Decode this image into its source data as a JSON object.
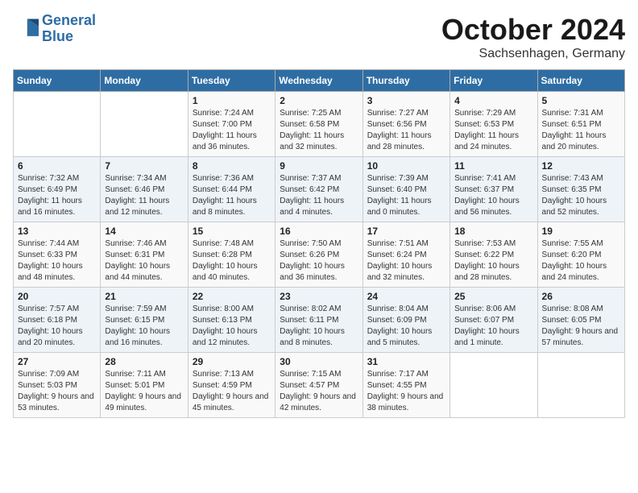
{
  "logo": {
    "line1": "General",
    "line2": "Blue"
  },
  "title": "October 2024",
  "location": "Sachsenhagen, Germany",
  "days_of_week": [
    "Sunday",
    "Monday",
    "Tuesday",
    "Wednesday",
    "Thursday",
    "Friday",
    "Saturday"
  ],
  "weeks": [
    [
      {
        "day": "",
        "sunrise": "",
        "sunset": "",
        "daylight": ""
      },
      {
        "day": "",
        "sunrise": "",
        "sunset": "",
        "daylight": ""
      },
      {
        "day": "1",
        "sunrise": "Sunrise: 7:24 AM",
        "sunset": "Sunset: 7:00 PM",
        "daylight": "Daylight: 11 hours and 36 minutes."
      },
      {
        "day": "2",
        "sunrise": "Sunrise: 7:25 AM",
        "sunset": "Sunset: 6:58 PM",
        "daylight": "Daylight: 11 hours and 32 minutes."
      },
      {
        "day": "3",
        "sunrise": "Sunrise: 7:27 AM",
        "sunset": "Sunset: 6:56 PM",
        "daylight": "Daylight: 11 hours and 28 minutes."
      },
      {
        "day": "4",
        "sunrise": "Sunrise: 7:29 AM",
        "sunset": "Sunset: 6:53 PM",
        "daylight": "Daylight: 11 hours and 24 minutes."
      },
      {
        "day": "5",
        "sunrise": "Sunrise: 7:31 AM",
        "sunset": "Sunset: 6:51 PM",
        "daylight": "Daylight: 11 hours and 20 minutes."
      }
    ],
    [
      {
        "day": "6",
        "sunrise": "Sunrise: 7:32 AM",
        "sunset": "Sunset: 6:49 PM",
        "daylight": "Daylight: 11 hours and 16 minutes."
      },
      {
        "day": "7",
        "sunrise": "Sunrise: 7:34 AM",
        "sunset": "Sunset: 6:46 PM",
        "daylight": "Daylight: 11 hours and 12 minutes."
      },
      {
        "day": "8",
        "sunrise": "Sunrise: 7:36 AM",
        "sunset": "Sunset: 6:44 PM",
        "daylight": "Daylight: 11 hours and 8 minutes."
      },
      {
        "day": "9",
        "sunrise": "Sunrise: 7:37 AM",
        "sunset": "Sunset: 6:42 PM",
        "daylight": "Daylight: 11 hours and 4 minutes."
      },
      {
        "day": "10",
        "sunrise": "Sunrise: 7:39 AM",
        "sunset": "Sunset: 6:40 PM",
        "daylight": "Daylight: 11 hours and 0 minutes."
      },
      {
        "day": "11",
        "sunrise": "Sunrise: 7:41 AM",
        "sunset": "Sunset: 6:37 PM",
        "daylight": "Daylight: 10 hours and 56 minutes."
      },
      {
        "day": "12",
        "sunrise": "Sunrise: 7:43 AM",
        "sunset": "Sunset: 6:35 PM",
        "daylight": "Daylight: 10 hours and 52 minutes."
      }
    ],
    [
      {
        "day": "13",
        "sunrise": "Sunrise: 7:44 AM",
        "sunset": "Sunset: 6:33 PM",
        "daylight": "Daylight: 10 hours and 48 minutes."
      },
      {
        "day": "14",
        "sunrise": "Sunrise: 7:46 AM",
        "sunset": "Sunset: 6:31 PM",
        "daylight": "Daylight: 10 hours and 44 minutes."
      },
      {
        "day": "15",
        "sunrise": "Sunrise: 7:48 AM",
        "sunset": "Sunset: 6:28 PM",
        "daylight": "Daylight: 10 hours and 40 minutes."
      },
      {
        "day": "16",
        "sunrise": "Sunrise: 7:50 AM",
        "sunset": "Sunset: 6:26 PM",
        "daylight": "Daylight: 10 hours and 36 minutes."
      },
      {
        "day": "17",
        "sunrise": "Sunrise: 7:51 AM",
        "sunset": "Sunset: 6:24 PM",
        "daylight": "Daylight: 10 hours and 32 minutes."
      },
      {
        "day": "18",
        "sunrise": "Sunrise: 7:53 AM",
        "sunset": "Sunset: 6:22 PM",
        "daylight": "Daylight: 10 hours and 28 minutes."
      },
      {
        "day": "19",
        "sunrise": "Sunrise: 7:55 AM",
        "sunset": "Sunset: 6:20 PM",
        "daylight": "Daylight: 10 hours and 24 minutes."
      }
    ],
    [
      {
        "day": "20",
        "sunrise": "Sunrise: 7:57 AM",
        "sunset": "Sunset: 6:18 PM",
        "daylight": "Daylight: 10 hours and 20 minutes."
      },
      {
        "day": "21",
        "sunrise": "Sunrise: 7:59 AM",
        "sunset": "Sunset: 6:15 PM",
        "daylight": "Daylight: 10 hours and 16 minutes."
      },
      {
        "day": "22",
        "sunrise": "Sunrise: 8:00 AM",
        "sunset": "Sunset: 6:13 PM",
        "daylight": "Daylight: 10 hours and 12 minutes."
      },
      {
        "day": "23",
        "sunrise": "Sunrise: 8:02 AM",
        "sunset": "Sunset: 6:11 PM",
        "daylight": "Daylight: 10 hours and 8 minutes."
      },
      {
        "day": "24",
        "sunrise": "Sunrise: 8:04 AM",
        "sunset": "Sunset: 6:09 PM",
        "daylight": "Daylight: 10 hours and 5 minutes."
      },
      {
        "day": "25",
        "sunrise": "Sunrise: 8:06 AM",
        "sunset": "Sunset: 6:07 PM",
        "daylight": "Daylight: 10 hours and 1 minute."
      },
      {
        "day": "26",
        "sunrise": "Sunrise: 8:08 AM",
        "sunset": "Sunset: 6:05 PM",
        "daylight": "Daylight: 9 hours and 57 minutes."
      }
    ],
    [
      {
        "day": "27",
        "sunrise": "Sunrise: 7:09 AM",
        "sunset": "Sunset: 5:03 PM",
        "daylight": "Daylight: 9 hours and 53 minutes."
      },
      {
        "day": "28",
        "sunrise": "Sunrise: 7:11 AM",
        "sunset": "Sunset: 5:01 PM",
        "daylight": "Daylight: 9 hours and 49 minutes."
      },
      {
        "day": "29",
        "sunrise": "Sunrise: 7:13 AM",
        "sunset": "Sunset: 4:59 PM",
        "daylight": "Daylight: 9 hours and 45 minutes."
      },
      {
        "day": "30",
        "sunrise": "Sunrise: 7:15 AM",
        "sunset": "Sunset: 4:57 PM",
        "daylight": "Daylight: 9 hours and 42 minutes."
      },
      {
        "day": "31",
        "sunrise": "Sunrise: 7:17 AM",
        "sunset": "Sunset: 4:55 PM",
        "daylight": "Daylight: 9 hours and 38 minutes."
      },
      {
        "day": "",
        "sunrise": "",
        "sunset": "",
        "daylight": ""
      },
      {
        "day": "",
        "sunrise": "",
        "sunset": "",
        "daylight": ""
      }
    ]
  ]
}
